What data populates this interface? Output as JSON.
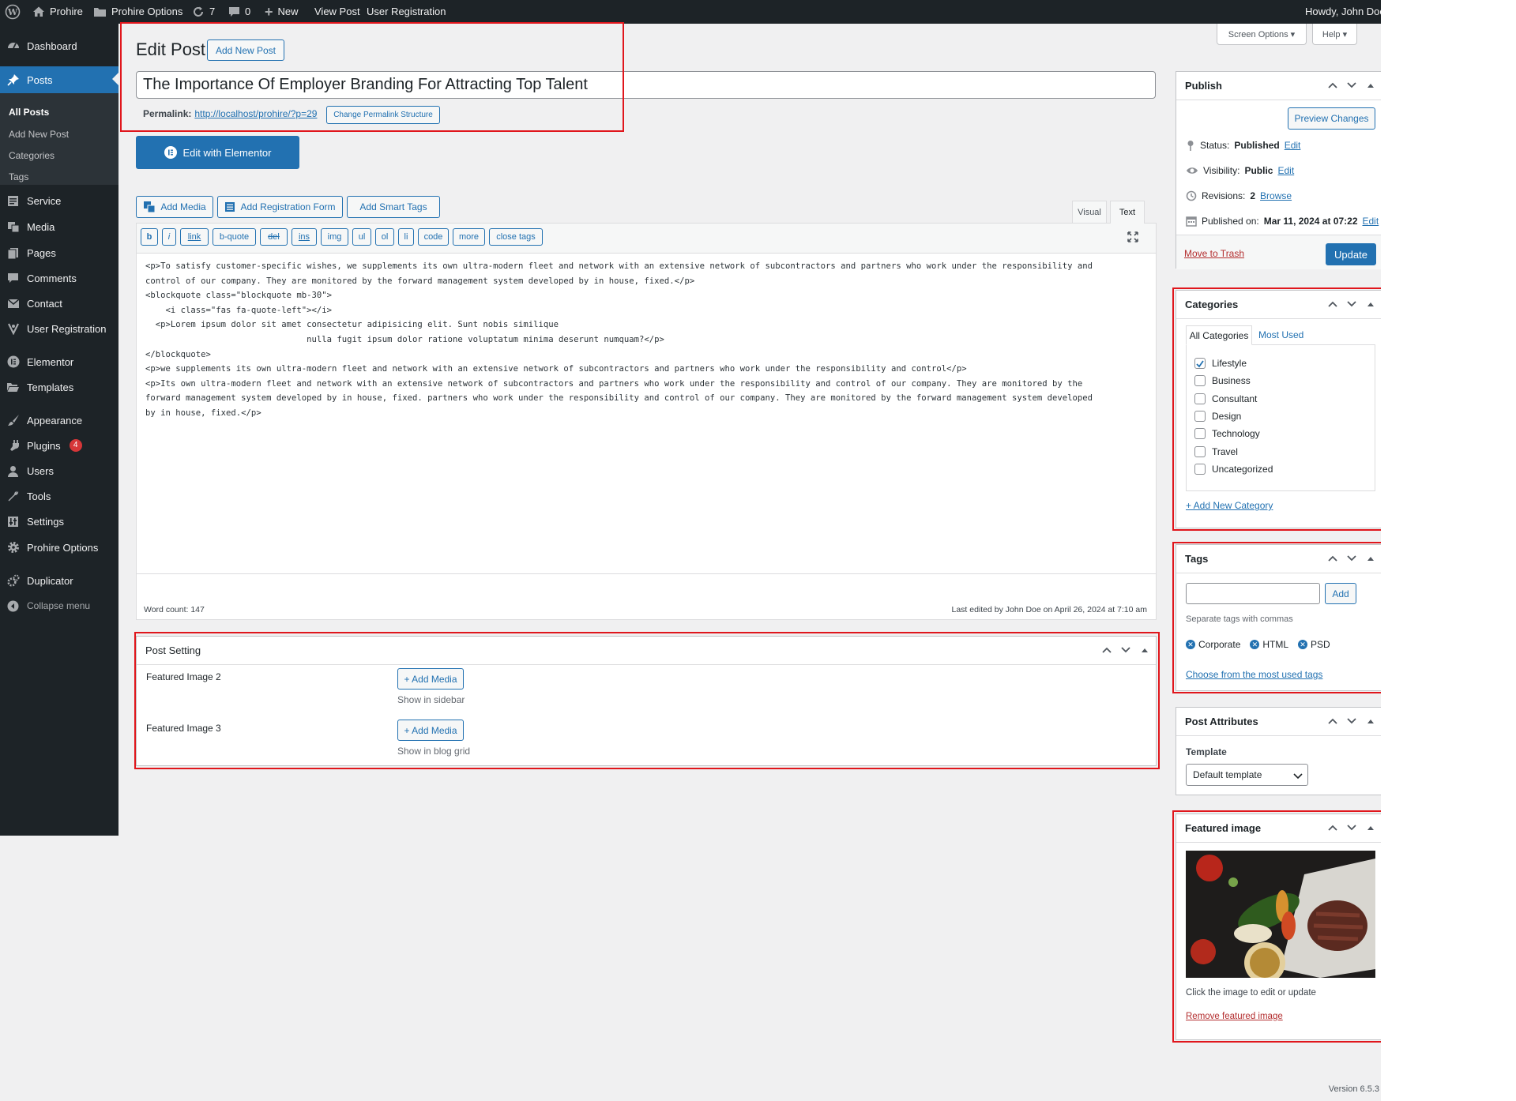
{
  "admin_bar": {
    "site_name": "Prohire",
    "options": "Prohire Options",
    "updates": "7",
    "comments": "0",
    "new": "New",
    "view_post": "View Post",
    "user_registration": "User Registration",
    "greeting": "Howdy, John Doe"
  },
  "sidebar": {
    "dashboard": "Dashboard",
    "posts": "Posts",
    "submenu": [
      "All Posts",
      "Add New Post",
      "Categories",
      "Tags"
    ],
    "service": "Service",
    "media": "Media",
    "pages": "Pages",
    "comments": "Comments",
    "contact": "Contact",
    "user_registration": "User Registration",
    "elementor": "Elementor",
    "templates": "Templates",
    "appearance": "Appearance",
    "plugins": "Plugins",
    "plugins_badge": "4",
    "users": "Users",
    "tools": "Tools",
    "settings": "Settings",
    "prohire_options": "Prohire Options",
    "duplicator": "Duplicator",
    "collapse": "Collapse menu"
  },
  "top_buttons": {
    "screen_options": "Screen Options ▾",
    "help": "Help ▾"
  },
  "editor": {
    "heading": "Edit Post",
    "add_new": "Add New Post",
    "title_value": "The Importance Of Employer Branding For Attracting Top Talent",
    "permalink_label": "Permalink:",
    "permalink_url": "http://localhost/prohire/?p=29",
    "change_permalink": "Change Permalink Structure",
    "elementor_button": "Edit with Elementor",
    "add_media": "Add Media",
    "add_registration_form": "Add Registration Form",
    "add_smart_tags": "Add Smart Tags",
    "tab_visual": "Visual",
    "tab_text": "Text",
    "quicktags": [
      "b",
      "i",
      "link",
      "b-quote",
      "del",
      "ins",
      "img",
      "ul",
      "ol",
      "li",
      "code",
      "more",
      "close tags"
    ],
    "content": "<p>To satisfy customer-specific wishes, we supplements its own ultra-modern fleet and network with an extensive network of subcontractors and partners who work under the responsibility and\ncontrol of our company. They are monitored by the forward management system developed by in house, fixed.</p>\n<blockquote class=\"blockquote mb-30\">\n    <i class=\"fas fa-quote-left\"></i>\n  <p>Lorem ipsum dolor sit amet consectetur adipisicing elit. Sunt nobis similique\n                                nulla fugit ipsum dolor ratione voluptatum minima deserunt numquam?</p>\n</blockquote>\n<p>we supplements its own ultra-modern fleet and network with an extensive network of subcontractors and partners who work under the responsibility and control</p>\n<p>Its own ultra-modern fleet and network with an extensive network of subcontractors and partners who work under the responsibility and control of our company. They are monitored by the\nforward management system developed by in house, fixed. partners who work under the responsibility and control of our company. They are monitored by the forward management system developed\nby in house, fixed.</p>",
    "word_count": "Word count: 147",
    "last_edited": "Last edited by John Doe on April 26, 2024 at 7:10 am"
  },
  "post_setting": {
    "title": "Post Setting",
    "rows": [
      {
        "label": "Featured Image 2",
        "button": "+ Add Media",
        "hint": "Show in sidebar"
      },
      {
        "label": "Featured Image 3",
        "button": "+ Add Media",
        "hint": "Show in blog grid"
      }
    ]
  },
  "publish": {
    "title": "Publish",
    "preview": "Preview Changes",
    "status_label": "Status:",
    "status_value": "Published",
    "visibility_label": "Visibility:",
    "visibility_value": "Public",
    "revisions_label": "Revisions:",
    "revisions_value": "2",
    "browse": "Browse",
    "published_label": "Published on:",
    "published_value": "Mar 11, 2024 at 07:22",
    "edit": "Edit",
    "trash": "Move to Trash",
    "update": "Update"
  },
  "categories": {
    "title": "Categories",
    "tab_all": "All Categories",
    "tab_most_used": "Most Used",
    "items": [
      {
        "name": "Lifestyle",
        "checked": true
      },
      {
        "name": "Business",
        "checked": false
      },
      {
        "name": "Consultant",
        "checked": false
      },
      {
        "name": "Design",
        "checked": false
      },
      {
        "name": "Technology",
        "checked": false
      },
      {
        "name": "Travel",
        "checked": false
      },
      {
        "name": "Uncategorized",
        "checked": false
      }
    ],
    "add_new": "+ Add New Category"
  },
  "tags": {
    "title": "Tags",
    "input_value": "",
    "add": "Add",
    "hint": "Separate tags with commas",
    "items": [
      "Corporate",
      "HTML",
      "PSD"
    ],
    "choose": "Choose from the most used tags"
  },
  "post_attributes": {
    "title": "Post Attributes",
    "template_label": "Template",
    "template_value": "Default template"
  },
  "featured_image": {
    "title": "Featured image",
    "hint": "Click the image to edit or update",
    "remove": "Remove featured image"
  },
  "footer": {
    "version": "Version 6.5.3"
  },
  "colors": {
    "accent": "#2271b1",
    "sidebar": "#1d2327",
    "highlight": "#e0161c",
    "danger": "#b32d2e"
  }
}
